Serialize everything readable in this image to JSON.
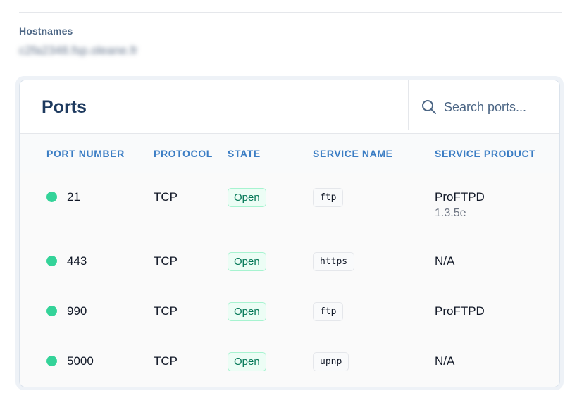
{
  "hostnames": {
    "label": "Hostnames",
    "value": "c2fa2348.fsp.oleane.fr"
  },
  "ports_card": {
    "title": "Ports",
    "search": {
      "placeholder": "Search ports...",
      "value": ""
    },
    "columns": [
      "PORT NUMBER",
      "PROTOCOL",
      "STATE",
      "SERVICE NAME",
      "SERVICE PRODUCT"
    ],
    "rows": [
      {
        "port": "21",
        "protocol": "TCP",
        "state": "Open",
        "service": "ftp",
        "product": "ProFTPD",
        "version": "1.3.5e",
        "status_color": "#34d399"
      },
      {
        "port": "443",
        "protocol": "TCP",
        "state": "Open",
        "service": "https",
        "product": "N/A",
        "version": "",
        "status_color": "#34d399"
      },
      {
        "port": "990",
        "protocol": "TCP",
        "state": "Open",
        "service": "ftp",
        "product": "ProFTPD",
        "version": "",
        "status_color": "#34d399"
      },
      {
        "port": "5000",
        "protocol": "TCP",
        "state": "Open",
        "service": "upnp",
        "product": "N/A",
        "version": "",
        "status_color": "#34d399"
      }
    ]
  },
  "colors": {
    "accent": "#3b7dc4",
    "title": "#1e3a5f",
    "open_badge_text": "#047857",
    "open_badge_bg": "#ecfdf5"
  }
}
